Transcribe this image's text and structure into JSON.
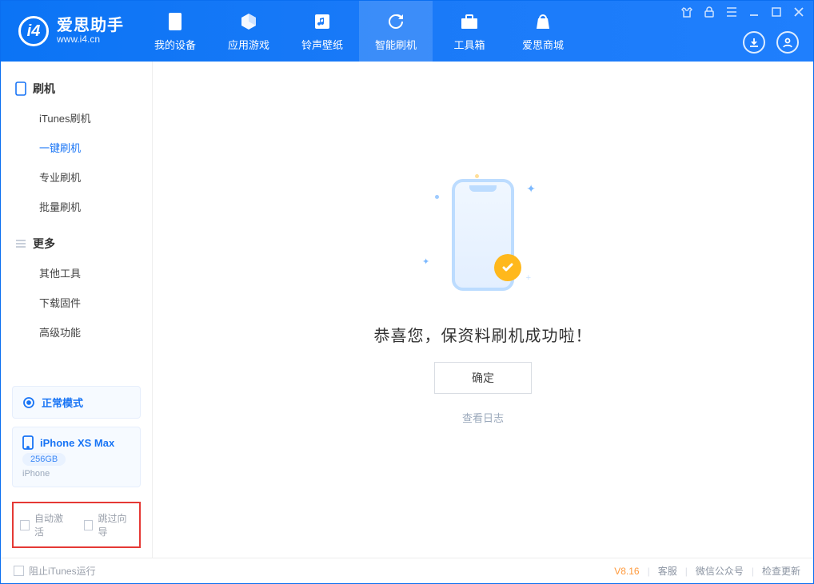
{
  "app": {
    "title": "爱思助手",
    "subtitle": "www.i4.cn"
  },
  "nav": {
    "items": [
      {
        "label": "我的设备"
      },
      {
        "label": "应用游戏"
      },
      {
        "label": "铃声壁纸"
      },
      {
        "label": "智能刷机"
      },
      {
        "label": "工具箱"
      },
      {
        "label": "爱思商城"
      }
    ]
  },
  "sidebar": {
    "group1": {
      "head": "刷机",
      "items": [
        {
          "label": "iTunes刷机"
        },
        {
          "label": "一键刷机"
        },
        {
          "label": "专业刷机"
        },
        {
          "label": "批量刷机"
        }
      ]
    },
    "group2": {
      "head": "更多",
      "items": [
        {
          "label": "其他工具"
        },
        {
          "label": "下载固件"
        },
        {
          "label": "高级功能"
        }
      ]
    },
    "mode_card": {
      "label": "正常模式"
    },
    "device_card": {
      "name": "iPhone XS Max",
      "storage": "256GB",
      "type": "iPhone"
    },
    "options": {
      "auto_activate": "自动激活",
      "skip_guide": "跳过向导"
    }
  },
  "main": {
    "success_title": "恭喜您，保资料刷机成功啦！",
    "ok_label": "确定",
    "view_log": "查看日志"
  },
  "footer": {
    "block_itunes": "阻止iTunes运行",
    "version": "V8.16",
    "links": {
      "support": "客服",
      "wechat": "微信公众号",
      "update": "检查更新"
    }
  },
  "icons": {
    "device": "device",
    "cube": "cube",
    "music": "music",
    "refresh": "refresh",
    "toolbox": "toolbox",
    "store": "store",
    "download": "download",
    "user": "user"
  }
}
